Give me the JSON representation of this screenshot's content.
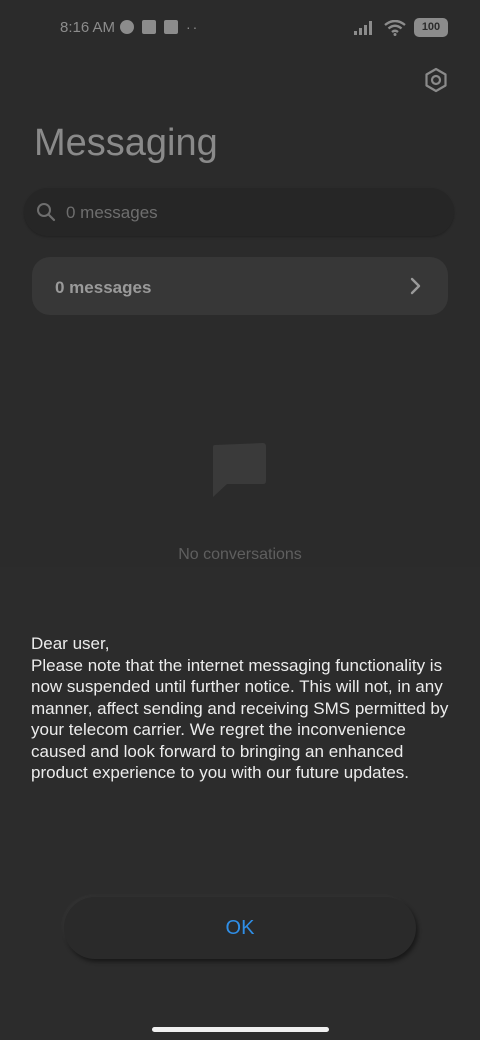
{
  "status_bar": {
    "time": "8:16 AM",
    "battery": "100",
    "notification_dots": "··"
  },
  "icons": {
    "settings": "settings-hexagon-icon",
    "search": "search-icon",
    "chevron": "chevron-right-icon",
    "empty": "chat-bubble-icon"
  },
  "header": {
    "title": "Messaging"
  },
  "search": {
    "placeholder": "0 messages"
  },
  "summary": {
    "label": "0 messages"
  },
  "empty_state": {
    "text": "No conversations"
  },
  "dialog": {
    "lines": [
      "Dear user,",
      "Please note that the internet messaging functionality is now suspended until further notice. This will not, in any manner, affect sending and receiving SMS permitted by your telecom carrier. We regret the inconvenience caused and look forward to bringing an enhanced product experience to you with our future updates."
    ],
    "ok_label": "OK"
  },
  "colors": {
    "background": "#2b2b2b",
    "dialog": "#2c2c2c",
    "accent": "#2f8ee6"
  }
}
